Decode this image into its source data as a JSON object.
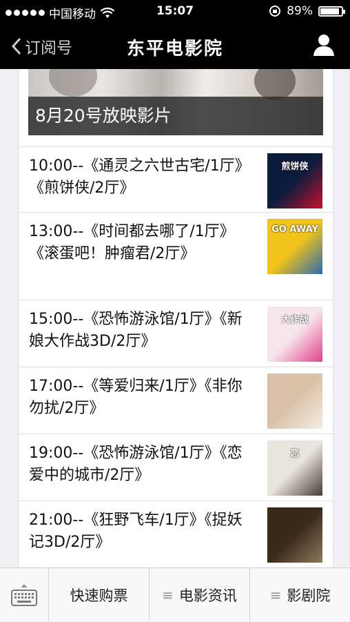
{
  "status_bar": {
    "carrier": "中国移动",
    "time": "15:07",
    "battery": "89%",
    "battery_level": 0.89
  },
  "nav": {
    "back_label": "订阅号",
    "title": "东平电影院"
  },
  "banner": {
    "caption": "8月20号放映影片"
  },
  "schedule": [
    {
      "text": "10:00--《通灵之六世古宅/1厅》《煎饼侠/2厅》",
      "poster_text": "煎饼侠",
      "colors": [
        "#0d1b3d",
        "#c8102e"
      ]
    },
    {
      "text": "13:00--《时间都去哪了/1厅》《滚蛋吧！肿瘤君/2厅》",
      "poster_text": "GO AWAY",
      "colors": [
        "#f2c31a",
        "#2b6bb0"
      ]
    },
    {
      "text": "15:00--《恐怖游泳馆/1厅》《新娘大作战3D/2厅》",
      "poster_text": "大作战",
      "colors": [
        "#f6e5ea",
        "#e0428a"
      ]
    },
    {
      "text": "17:00--《等爱归来/1厅》《非你勿扰/2厅》",
      "poster_text": "",
      "colors": [
        "#d9c2a8",
        "#f3ede6"
      ]
    },
    {
      "text": "19:00--《恐怖游泳馆/1厅》《恋爱中的城市/2厅》",
      "poster_text": "恋",
      "colors": [
        "#e9e4dc",
        "#4a3b36"
      ]
    },
    {
      "text": "21:00--《狂野飞车/1厅》《捉妖记3D/2厅》",
      "poster_text": "",
      "colors": [
        "#3a2a1c",
        "#8c7a5a"
      ]
    }
  ],
  "tabbar": {
    "tabs": [
      "快速购票",
      "电影资讯",
      "影剧院"
    ]
  }
}
